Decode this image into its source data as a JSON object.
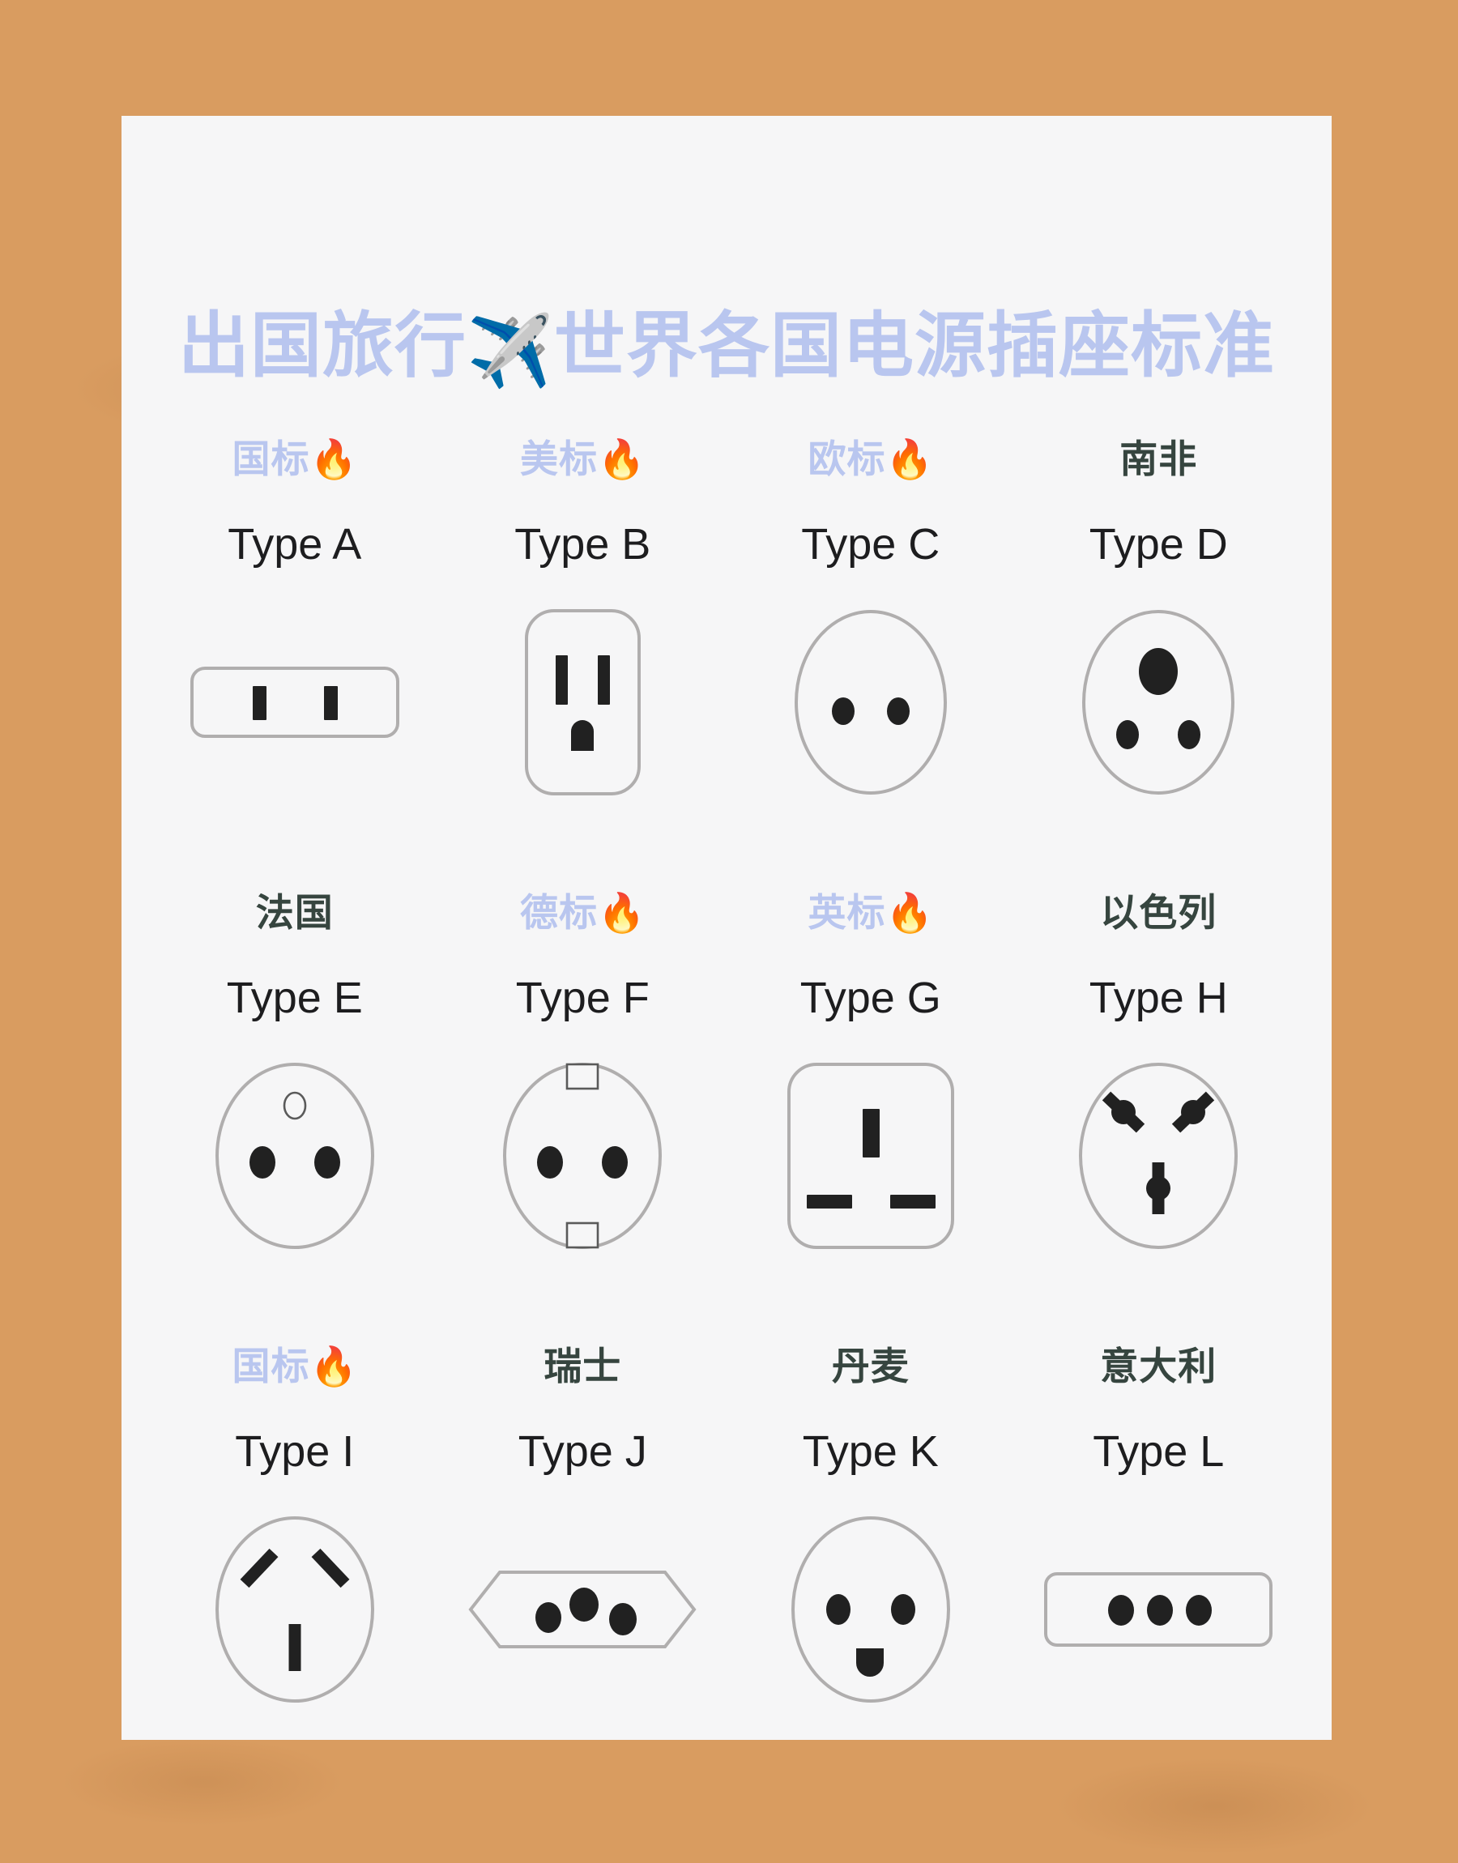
{
  "poster": {
    "title_before": "出国旅行",
    "title_icon": "✈️",
    "title_icon_name": "airplane-emoji",
    "title_after": "世界各国电源插座标准",
    "background": "wood-plank-table",
    "card_color": "#f6f6f7",
    "accent_blue": "#b9c6ef",
    "text_dark": "#36453f",
    "type_text": "#1d1d1f",
    "socket_outline": "#b0aeae",
    "socket_hole": "#212121"
  },
  "sockets": [
    {
      "country": "国标",
      "fire": "🔥",
      "has_fire": true,
      "country_style": "blue",
      "type": "Type A",
      "shape": "horizontal-rounded-rect-two-vertical-slots"
    },
    {
      "country": "美标",
      "fire": "🔥",
      "has_fire": true,
      "country_style": "blue",
      "type": "Type B",
      "shape": "rounded-square-two-slots-plus-ground"
    },
    {
      "country": "欧标",
      "fire": "🔥",
      "has_fire": true,
      "country_style": "blue",
      "type": "Type C",
      "shape": "circle-two-round-holes"
    },
    {
      "country": "南非",
      "fire": "",
      "has_fire": false,
      "country_style": "dark",
      "type": "Type D",
      "shape": "circle-large-top-hole-two-small-bottom"
    },
    {
      "country": "法国",
      "fire": "",
      "has_fire": false,
      "country_style": "dark",
      "type": "Type E",
      "shape": "circle-two-holes-plus-top-earth-pin"
    },
    {
      "country": "德标",
      "fire": "🔥",
      "has_fire": true,
      "country_style": "blue",
      "type": "Type F",
      "shape": "circle-two-holes-plus-earth-clips"
    },
    {
      "country": "英标",
      "fire": "🔥",
      "has_fire": true,
      "country_style": "blue",
      "type": "Type G",
      "shape": "rounded-square-vertical-top-two-horizontal-bottom"
    },
    {
      "country": "以色列",
      "fire": "",
      "has_fire": false,
      "country_style": "dark",
      "type": "Type H",
      "shape": "circle-two-angled-slots-plus-vertical"
    },
    {
      "country": "国标",
      "fire": "🔥",
      "has_fire": true,
      "country_style": "blue",
      "type": "Type I",
      "shape": "circle-inverted-v-slots-plus-vertical"
    },
    {
      "country": "瑞士",
      "fire": "",
      "has_fire": false,
      "country_style": "dark",
      "type": "Type J",
      "shape": "hexagon-three-holes"
    },
    {
      "country": "丹麦",
      "fire": "",
      "has_fire": false,
      "country_style": "dark",
      "type": "Type K",
      "shape": "circle-two-holes-plus-smile-ground"
    },
    {
      "country": "意大利",
      "fire": "",
      "has_fire": false,
      "country_style": "dark",
      "type": "Type L",
      "shape": "horizontal-rounded-rect-three-holes"
    }
  ]
}
